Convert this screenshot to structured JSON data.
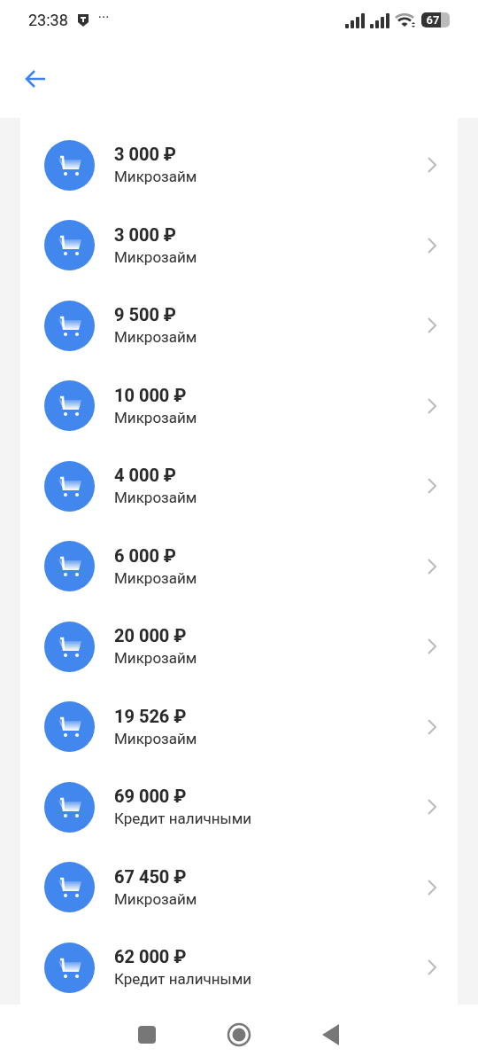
{
  "status_bar": {
    "time": "23:38",
    "more": "···",
    "battery": "67"
  },
  "loans": [
    {
      "amount": "3 000 ₽",
      "type": "Микрозайм"
    },
    {
      "amount": "3 000 ₽",
      "type": "Микрозайм"
    },
    {
      "amount": "9 500 ₽",
      "type": "Микрозайм"
    },
    {
      "amount": "10 000 ₽",
      "type": "Микрозайм"
    },
    {
      "amount": "4 000 ₽",
      "type": "Микрозайм"
    },
    {
      "amount": "6 000 ₽",
      "type": "Микрозайм"
    },
    {
      "amount": "20 000 ₽",
      "type": "Микрозайм"
    },
    {
      "amount": "19 526 ₽",
      "type": "Микрозайм"
    },
    {
      "amount": "69 000 ₽",
      "type": "Кредит наличными"
    },
    {
      "amount": "67 450 ₽",
      "type": "Микрозайм"
    },
    {
      "amount": "62 000 ₽",
      "type": "Кредит наличными"
    }
  ]
}
